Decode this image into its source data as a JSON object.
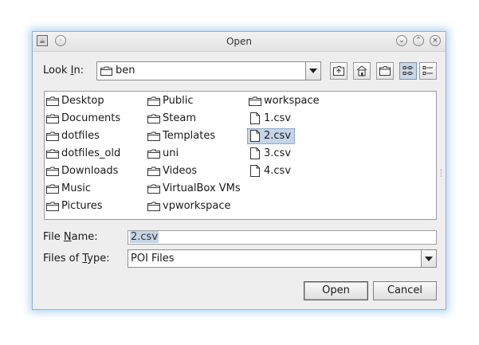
{
  "dialog": {
    "title": "Open",
    "app_icon_glyph": "☕"
  },
  "look_in": {
    "label_prefix": "Look ",
    "label_mnemonic": "I",
    "label_suffix": "n:",
    "value": "ben"
  },
  "toolbar": {
    "up_one_level": "up-folder-icon",
    "home": "home-icon",
    "new_folder": "new-folder-icon",
    "list_view": "list-view-icon",
    "details_view": "details-view-icon"
  },
  "files": {
    "col1": [
      {
        "name": "Desktop",
        "icon": "folder-icon"
      },
      {
        "name": "Documents",
        "icon": "folder-icon"
      },
      {
        "name": "dotfiles",
        "icon": "folder-icon"
      },
      {
        "name": "dotfiles_old",
        "icon": "folder-icon"
      },
      {
        "name": "Downloads",
        "icon": "folder-icon"
      },
      {
        "name": "Music",
        "icon": "folder-icon"
      },
      {
        "name": "Pictures",
        "icon": "folder-icon"
      }
    ],
    "col2": [
      {
        "name": "Public",
        "icon": "folder-icon"
      },
      {
        "name": "Steam",
        "icon": "folder-icon"
      },
      {
        "name": "Templates",
        "icon": "folder-icon"
      },
      {
        "name": "uni",
        "icon": "folder-icon"
      },
      {
        "name": "Videos",
        "icon": "folder-icon"
      },
      {
        "name": "VirtualBox VMs",
        "icon": "folder-icon"
      },
      {
        "name": "vpworkspace",
        "icon": "folder-icon"
      }
    ],
    "col3": [
      {
        "name": "workspace",
        "icon": "folder-icon"
      },
      {
        "name": "1.csv",
        "icon": "file-icon"
      },
      {
        "name": "2.csv",
        "icon": "file-icon",
        "selected": true
      },
      {
        "name": "3.csv",
        "icon": "file-icon"
      },
      {
        "name": "4.csv",
        "icon": "file-icon"
      }
    ]
  },
  "file_name": {
    "label_prefix": "File ",
    "label_mnemonic": "N",
    "label_suffix": "ame:",
    "value": "2.csv"
  },
  "files_of_type": {
    "label_prefix": "Files of ",
    "label_mnemonic": "T",
    "label_suffix": "ype:",
    "value": "POI Files"
  },
  "buttons": {
    "open": "Open",
    "cancel": "Cancel"
  },
  "colors": {
    "selection": "#c5d5e7",
    "dialog_bg": "#eeeeee",
    "glow": "#78afe1"
  }
}
